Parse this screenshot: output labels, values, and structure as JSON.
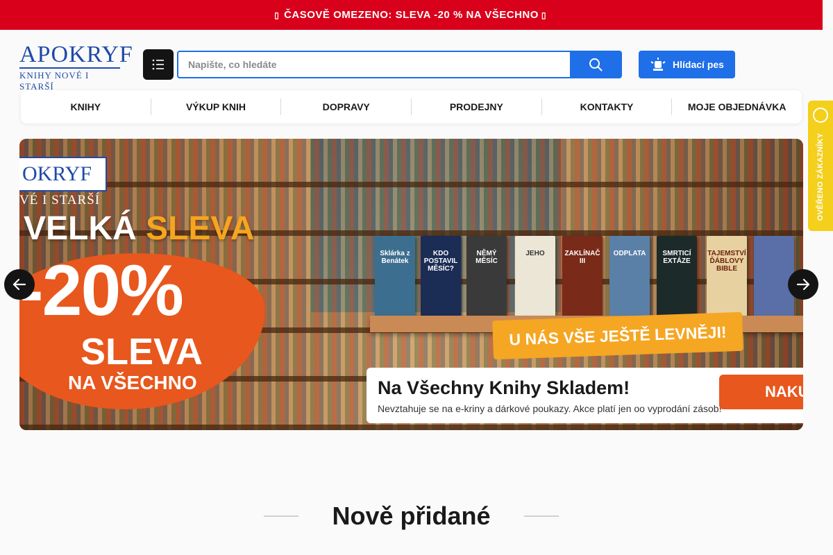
{
  "announcement": {
    "icon_left": "fire-icon",
    "text": "ČASOVĚ OMEZENO: SLEVA -20 % NA VŠECHNO",
    "icon_right": "fire-icon"
  },
  "logo": {
    "line1": "APOKRYF",
    "line2": "KNIHY NOVÉ I STARŠÍ"
  },
  "search": {
    "placeholder": "Napište, co hledáte",
    "value": ""
  },
  "watchdog": {
    "label": "Hlídací pes",
    "icon": "siren-icon"
  },
  "nav": {
    "items": [
      {
        "label": "KNIHY"
      },
      {
        "label": "VÝKUP KNIH"
      },
      {
        "label": "DOPRAVY"
      },
      {
        "label": "PRODEJNY"
      },
      {
        "label": "KONTAKTY"
      },
      {
        "label": "MOJE OBJEDNÁVKA"
      }
    ]
  },
  "verified_badge": {
    "text": "OVĚŘENO ZÁKAZNÍKY"
  },
  "banner": {
    "logo_text": "OKRYF",
    "logo_sub": "VÉ I STARŠÍ",
    "headline_white": "VELKÁ",
    "headline_yellow": "SLEVA",
    "discount": "-20%",
    "sleva": "SLEVA",
    "na_vsechno": "NA VŠECHNO",
    "books": [
      {
        "title": "Sklárka z Benátek",
        "color": "#3c6e8f"
      },
      {
        "title": "KDO POSTAVIL MĚSÍC?",
        "color": "#1b2c55"
      },
      {
        "title": "NĚMÝ MĚSÍC",
        "color": "#3a3a3a"
      },
      {
        "title": "JEHO",
        "color": "#ece6d6"
      },
      {
        "title": "ZAKLÍNAČ III",
        "color": "#7a2a18"
      },
      {
        "title": "ODPLATA",
        "color": "#5a80a8"
      },
      {
        "title": "SMRTICÍ EXTÁZE",
        "color": "#1d2a2a"
      },
      {
        "title": "TAJEMSTVÍ ĎÁBLOVY BIBLE",
        "color": "#e8d1a0"
      },
      {
        "title": "",
        "color": "#5a6fa8"
      }
    ],
    "cta_top": "U NÁS VŠE JEŠTĚ LEVNĚJI!",
    "cta_main": "Na Všechny Knihy Skladem!",
    "cta_note": "Nevztahuje se na e-kriny a dárkové poukazy. Akce platí jen oo vyprodání zásob!",
    "cta_button": "NAKUP"
  },
  "section": {
    "title": "Nově přidané"
  }
}
